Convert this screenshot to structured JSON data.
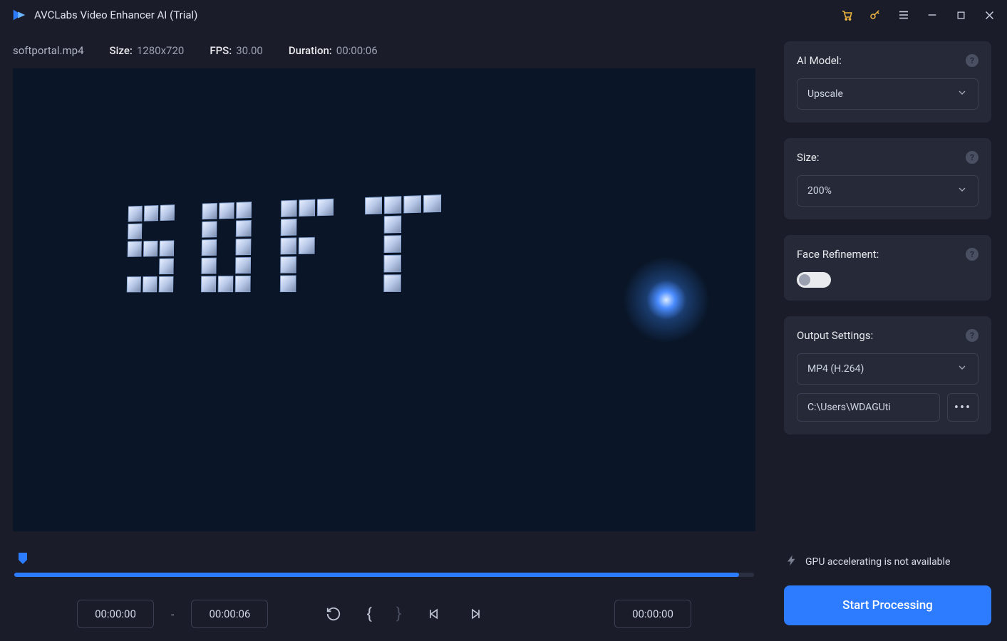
{
  "titlebar": {
    "app_title": "AVCLabs Video Enhancer AI (Trial)"
  },
  "file": {
    "name": "softportal.mp4",
    "size_label": "Size:",
    "size_value": "1280x720",
    "fps_label": "FPS:",
    "fps_value": "30.00",
    "duration_label": "Duration:",
    "duration_value": "00:00:06"
  },
  "timeline": {
    "start_time": "00:00:00",
    "end_time": "00:00:06",
    "current_time": "00:00:00"
  },
  "panels": {
    "ai_model": {
      "title": "AI Model:",
      "value": "Upscale"
    },
    "size": {
      "title": "Size:",
      "value": "200%"
    },
    "face": {
      "title": "Face Refinement:"
    },
    "output": {
      "title": "Output Settings:",
      "format": "MP4 (H.264)",
      "path": "C:\\Users\\WDAGUti"
    }
  },
  "gpu": {
    "text": "GPU accelerating is not available"
  },
  "actions": {
    "start": "Start Processing"
  }
}
